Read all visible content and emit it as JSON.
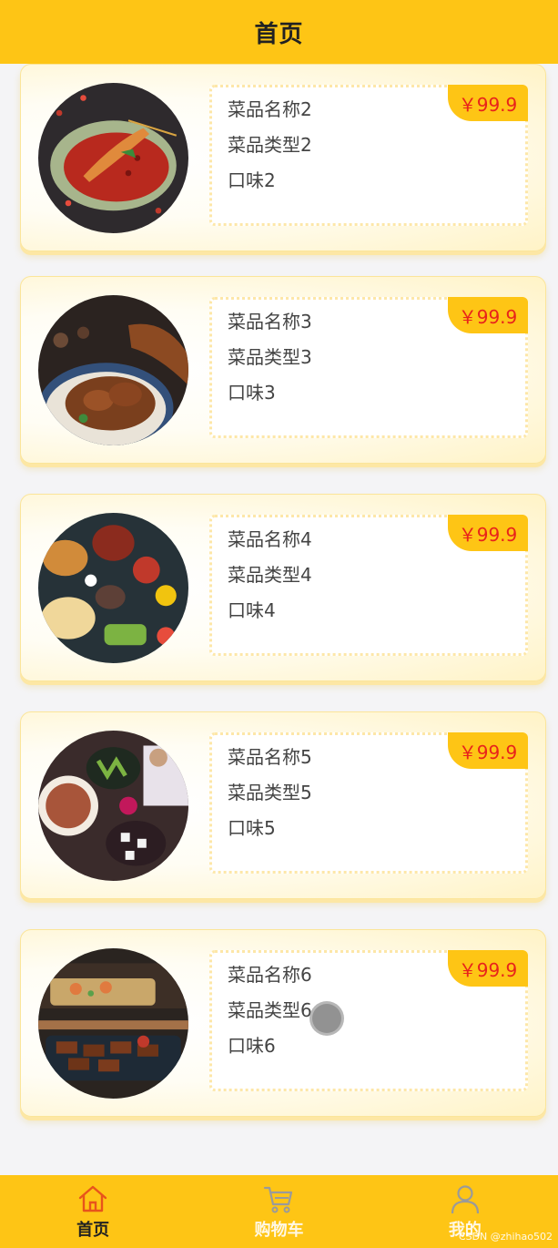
{
  "header": {
    "title": "首页"
  },
  "dishes": [
    {
      "name": "菜品名称2",
      "type": "菜品类型2",
      "taste": "口味2",
      "price": "￥99.9"
    },
    {
      "name": "菜品名称3",
      "type": "菜品类型3",
      "taste": "口味3",
      "price": "￥99.9"
    },
    {
      "name": "菜品名称4",
      "type": "菜品类型4",
      "taste": "口味4",
      "price": "￥99.9"
    },
    {
      "name": "菜品名称5",
      "type": "菜品类型5",
      "taste": "口味5",
      "price": "￥99.9"
    },
    {
      "name": "菜品名称6",
      "type": "菜品类型6",
      "taste": "口味6",
      "price": "￥99.9"
    }
  ],
  "tabbar": {
    "items": [
      {
        "label": "首页",
        "icon": "home-icon",
        "active": true
      },
      {
        "label": "购物车",
        "icon": "cart-icon",
        "active": false
      },
      {
        "label": "我的",
        "icon": "user-icon",
        "active": false
      }
    ]
  },
  "watermark": "CSDN @zhihao502",
  "colors": {
    "accent": "#fec515",
    "price": "#e8231b",
    "background": "#f4f4f6"
  }
}
